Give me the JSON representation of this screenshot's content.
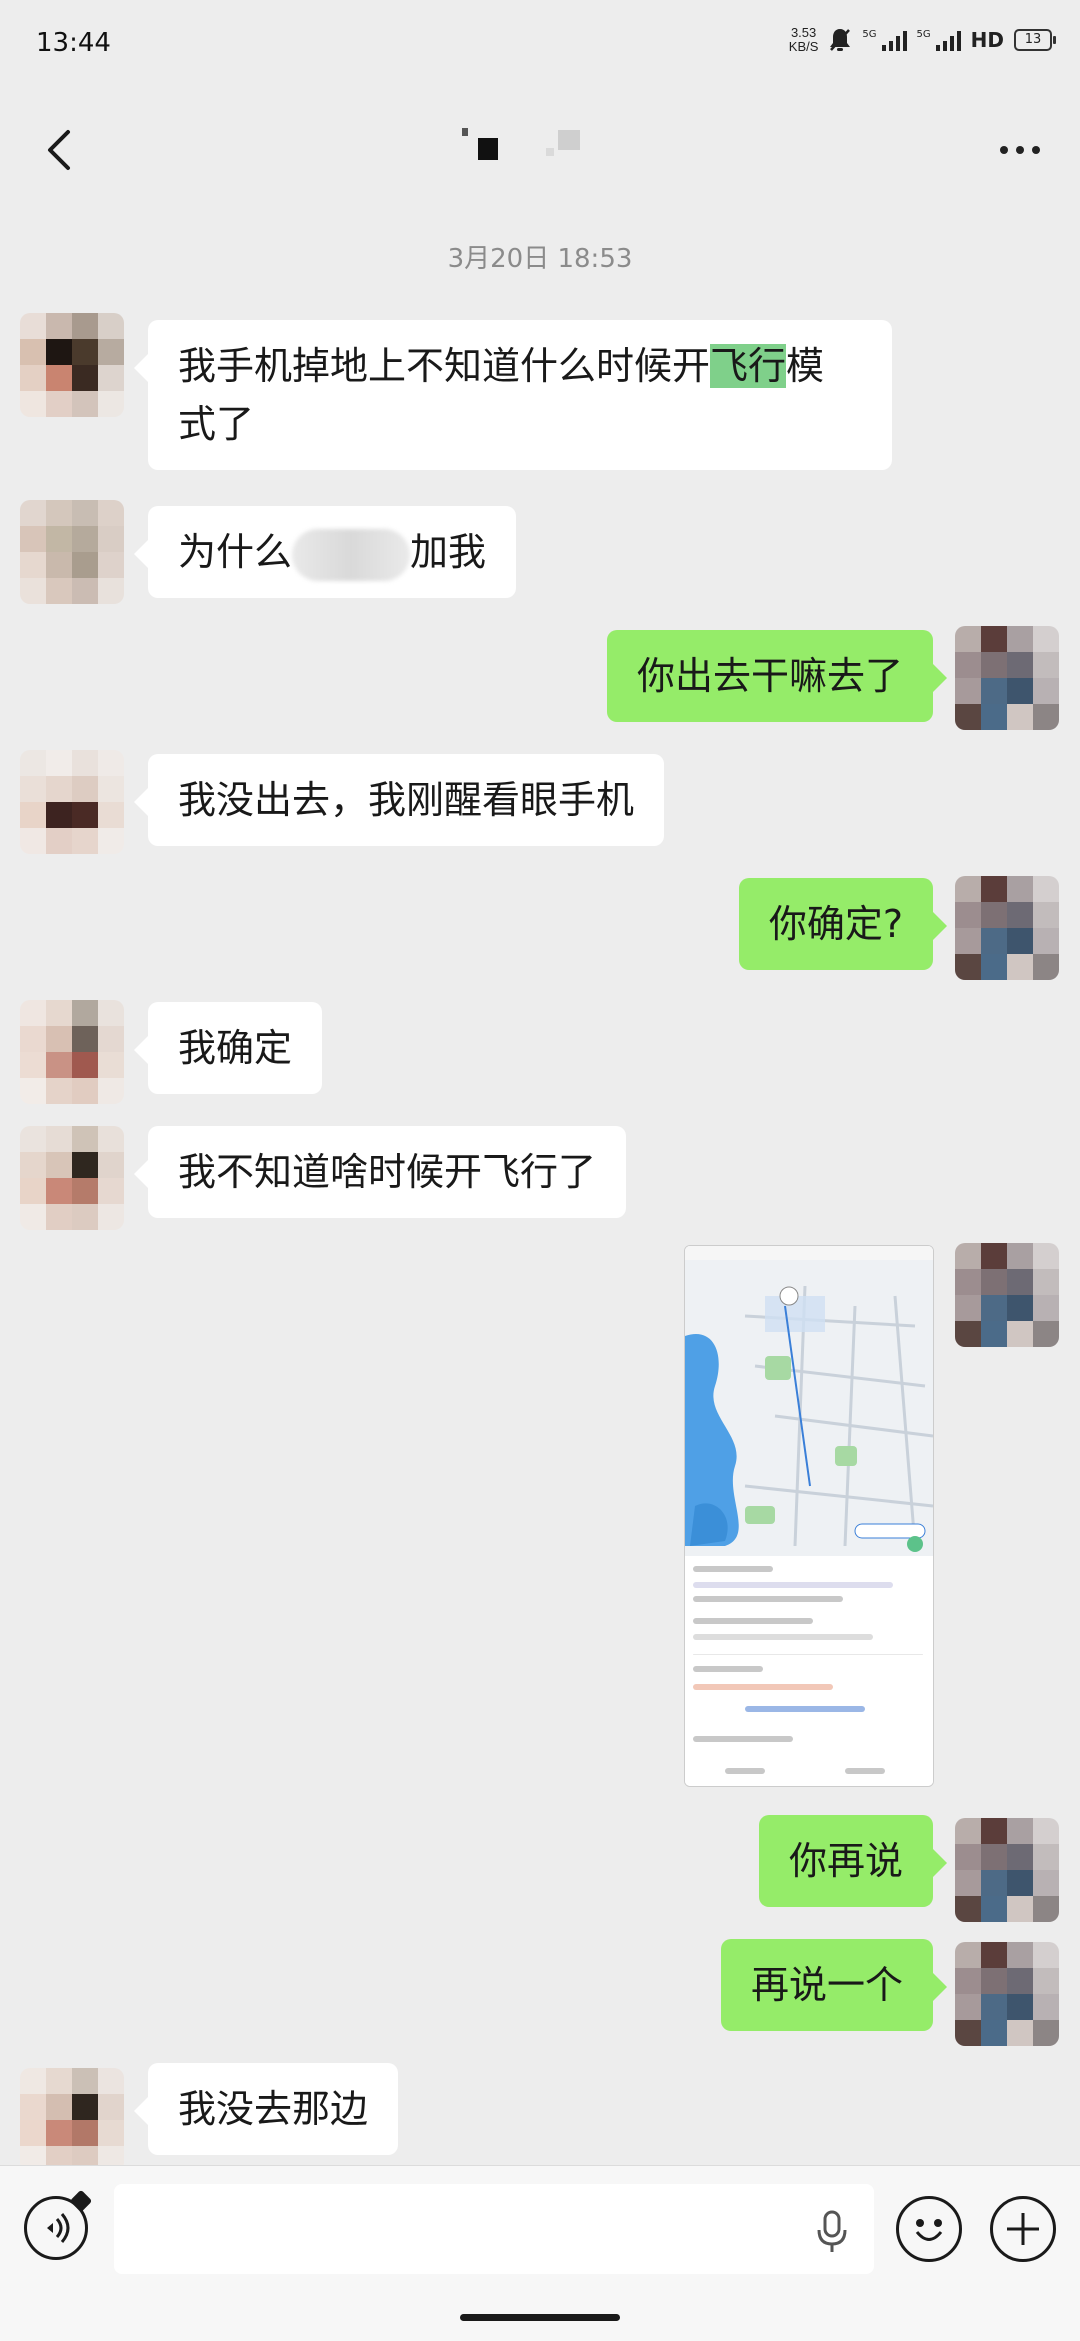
{
  "status_bar": {
    "time": "13:44",
    "net_speed_value": "3.53",
    "net_speed_unit": "KB/S",
    "hd": "HD",
    "battery": "13"
  },
  "header": {
    "title": ""
  },
  "timestamp": "3月20日 18:53",
  "messages": [
    {
      "side": "in",
      "pre": "我手机掉地上不知道什么时候开",
      "highlight": "飞行",
      "post": "模式了"
    },
    {
      "side": "in",
      "pre": "为什么",
      "post": "加我"
    },
    {
      "side": "out",
      "text": "你出去干嘛去了"
    },
    {
      "side": "in",
      "text": "我没出去，我刚醒看眼手机"
    },
    {
      "side": "out",
      "text": "你确定?"
    },
    {
      "side": "in",
      "text": "我确定"
    },
    {
      "side": "in",
      "text": "我不知道啥时候开飞行了"
    },
    {
      "side": "out",
      "type": "image"
    },
    {
      "side": "out",
      "text": "你再说"
    },
    {
      "side": "out",
      "text": "再说一个"
    },
    {
      "side": "in",
      "text": "我没去那边"
    }
  ],
  "input": {
    "placeholder": ""
  },
  "icons": {
    "back": "back-arrow-icon",
    "more": "more-dots-icon",
    "voice": "voice-mode-icon",
    "mic": "microphone-icon",
    "emoji": "emoji-icon",
    "plus": "plus-icon"
  },
  "colors": {
    "background": "#ededed",
    "incoming_bubble": "#ffffff",
    "outgoing_bubble": "#95ec69",
    "highlight": "#7fd08a"
  }
}
